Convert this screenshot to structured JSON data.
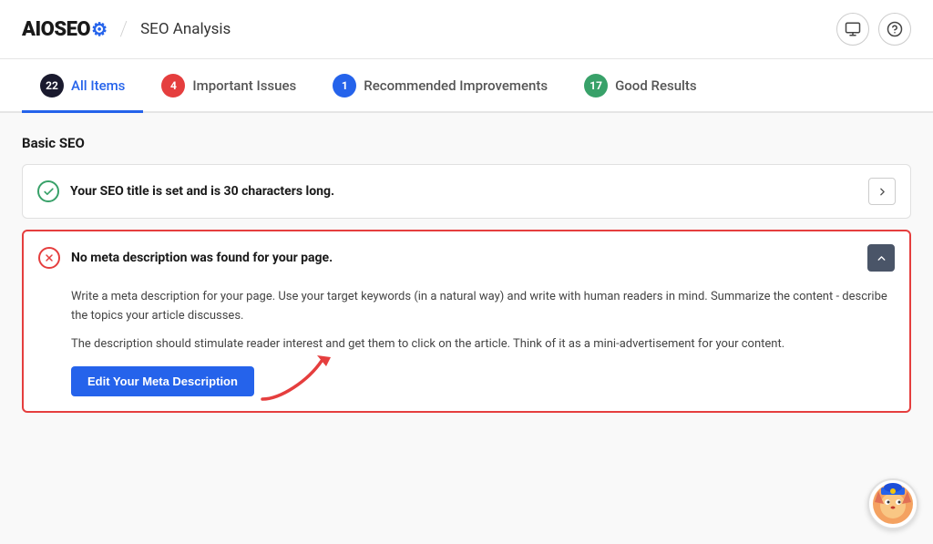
{
  "header": {
    "logo_aio": "AIO",
    "logo_seo": "SEO",
    "title": "SEO Analysis",
    "monitor_icon": "monitor-icon",
    "help_icon": "help-icon"
  },
  "tabs": [
    {
      "id": "all-items",
      "label": "All Items",
      "badge": "22",
      "badge_color": "badge-dark",
      "active": true
    },
    {
      "id": "important-issues",
      "label": "Important Issues",
      "badge": "4",
      "badge_color": "badge-red",
      "active": false
    },
    {
      "id": "recommended-improvements",
      "label": "Recommended Improvements",
      "badge": "1",
      "badge_color": "badge-blue",
      "active": false
    },
    {
      "id": "good-results",
      "label": "Good Results",
      "badge": "17",
      "badge_color": "badge-green",
      "active": false
    }
  ],
  "main": {
    "section_title": "Basic SEO",
    "cards": [
      {
        "id": "seo-title",
        "status": "success",
        "text": "Your SEO title is set and is 30 characters long.",
        "expanded": false
      },
      {
        "id": "meta-description",
        "status": "error",
        "text": "No meta description was found for your page.",
        "expanded": true,
        "body_p1": "Write a meta description for your page. Use your target keywords (in a natural way) and write with human readers in mind. Summarize the content - describe the topics your article discusses.",
        "body_p2": "The description should stimulate reader interest and get them to click on the article. Think of it as a mini-advertisement for your content.",
        "button_label": "Edit Your Meta Description"
      }
    ]
  }
}
